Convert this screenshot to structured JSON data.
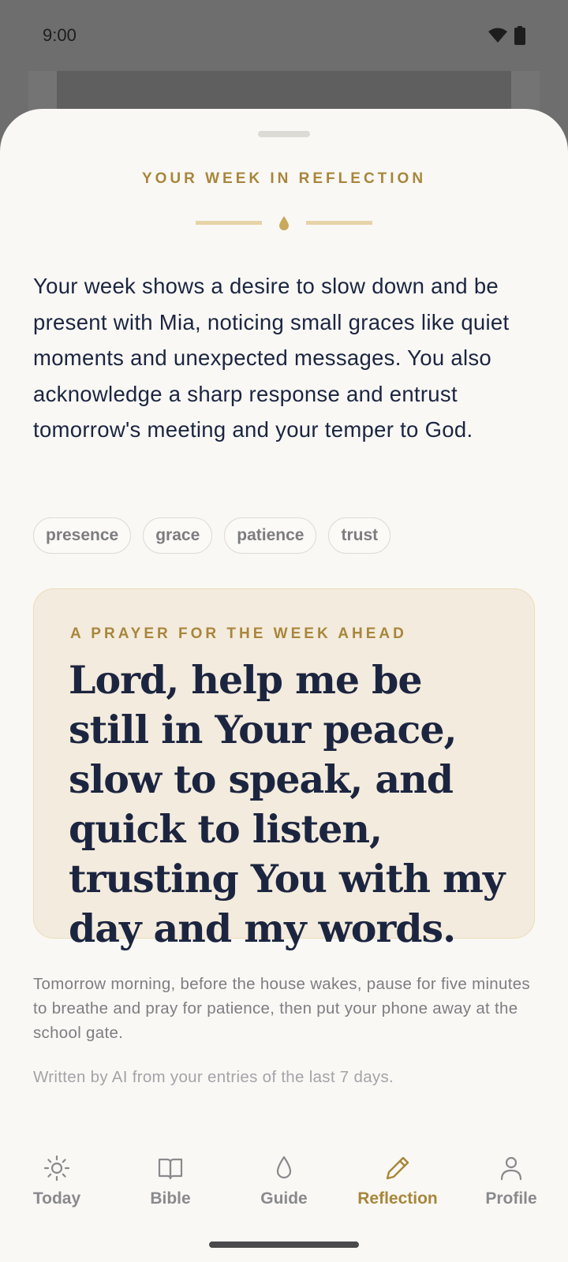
{
  "status_bar": {
    "time": "9:00"
  },
  "sheet": {
    "eyebrow": "YOUR WEEK IN REFLECTION",
    "summary": "Your week shows a desire to slow down and be present with Mia, noticing small graces like quiet moments and unexpected messages. You also acknowledge a sharp response and entrust tomorrow's meeting and your temper to God.",
    "tags": [
      "presence",
      "grace",
      "patience",
      "trust"
    ],
    "prayer": {
      "label": "A PRAYER FOR THE WEEK AHEAD",
      "text": "Lord, help me be still in Your peace, slow to speak, and quick to listen, trusting You with my day and my words."
    },
    "suggestion": "Tomorrow morning, before the house wakes, pause for five minutes to breathe and pray for patience, then put your phone away at the school gate.",
    "disclaimer": "Written by AI from your entries of the last 7 days."
  },
  "nav": {
    "items": [
      {
        "label": "Today",
        "icon": "sun-icon"
      },
      {
        "label": "Bible",
        "icon": "book-icon"
      },
      {
        "label": "Guide",
        "icon": "drop-icon"
      },
      {
        "label": "Reflection",
        "icon": "pencil-icon",
        "active": true
      },
      {
        "label": "Profile",
        "icon": "person-icon"
      }
    ]
  },
  "colors": {
    "accent": "#a8863b",
    "text": "#1c2540",
    "sheet": "#f9f8f5",
    "prayer_card": "#f3ebdd"
  }
}
